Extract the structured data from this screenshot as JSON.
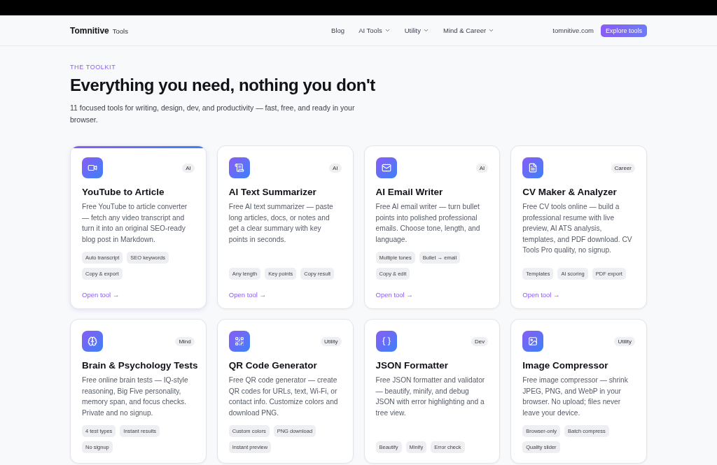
{
  "nav": {
    "brand": "Tomnitive",
    "brand_suffix": "Tools",
    "links": [
      {
        "label": "Blog",
        "dropdown": false
      },
      {
        "label": "AI Tools",
        "dropdown": true
      },
      {
        "label": "Utility",
        "dropdown": true
      },
      {
        "label": "Mind & Career",
        "dropdown": true
      }
    ],
    "site": "tomnitive.com",
    "cta": "Explore tools"
  },
  "hero": {
    "eyebrow": "THE TOOLKIT",
    "title": "Everything you need, nothing you don't",
    "subtitle": "11 focused tools for writing, design, dev, and productivity — fast, free, and ready in your browser."
  },
  "cards": [
    {
      "title": "YouTube to Article",
      "category": "AI",
      "highlighted": true,
      "description": "Free YouTube to article converter — fetch any video transcript and turn it into an original SEO-ready blog post in Markdown.",
      "tags": [
        "Auto transcript",
        "SEO keywords",
        "Copy & export"
      ],
      "link": "Open tool →"
    },
    {
      "title": "AI Text Summarizer",
      "category": "AI",
      "highlighted": false,
      "description": "Free AI text summarizer — paste long articles, docs, or notes and get a clear summary with key points in seconds.",
      "tags": [
        "Any length",
        "Key points",
        "Copy result"
      ],
      "link": "Open tool →"
    },
    {
      "title": "AI Email Writer",
      "category": "AI",
      "highlighted": false,
      "description": "Free AI email writer — turn bullet points into polished professional emails. Choose tone, length, and language.",
      "tags": [
        "Multiple tones",
        "Bullet → email",
        "Copy & edit"
      ],
      "link": "Open tool →"
    },
    {
      "title": "CV Maker & Analyzer",
      "category": "Career",
      "highlighted": false,
      "description": "Free CV tools online — build a professional resume with live preview, AI ATS analysis, templates, and PDF download. CV Tools Pro quality, no signup.",
      "tags": [
        "Templates",
        "AI scoring",
        "PDF export"
      ],
      "link": "Open tool →"
    },
    {
      "title": "Brain & Psychology Tests",
      "category": "Mind",
      "highlighted": false,
      "description": "Free online brain tests — IQ-style reasoning, Big Five personality, memory span, and focus checks. Private and no signup.",
      "tags": [
        "4 test types",
        "Instant results",
        "No signup"
      ]
    },
    {
      "title": "QR Code Generator",
      "category": "Utility",
      "highlighted": false,
      "description": "Free QR code generator — create QR codes for URLs, text, Wi-Fi, or contact info. Customize colors and download PNG.",
      "tags": [
        "Custom colors",
        "PNG download",
        "Instant preview"
      ]
    },
    {
      "title": "JSON Formatter",
      "category": "Dev",
      "highlighted": false,
      "description": "Free JSON formatter and validator — beautify, minify, and debug JSON with error highlighting and a tree view.",
      "tags": [
        "Beautify",
        "Minify",
        "Error check"
      ]
    },
    {
      "title": "Image Compressor",
      "category": "Utility",
      "highlighted": false,
      "description": "Free image compressor — shrink JPEG, PNG, and WebP in your browser. No upload; files never leave your device.",
      "tags": [
        "Browser-only",
        "Batch compress",
        "Quality slider"
      ]
    }
  ]
}
